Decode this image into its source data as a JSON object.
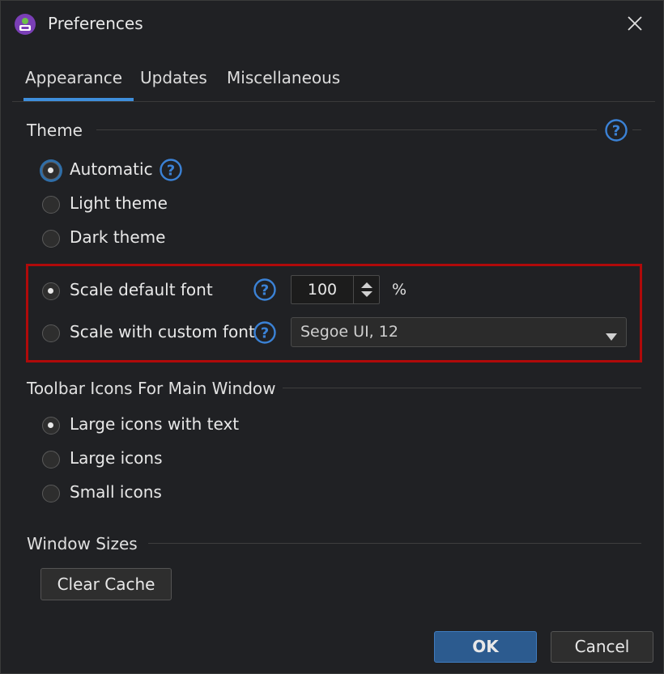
{
  "window": {
    "title": "Preferences"
  },
  "tabs": [
    {
      "label": "Appearance",
      "active": true
    },
    {
      "label": "Updates",
      "active": false
    },
    {
      "label": "Miscellaneous",
      "active": false
    }
  ],
  "theme": {
    "header": "Theme",
    "options": [
      {
        "label": "Automatic",
        "checked": true
      },
      {
        "label": "Light theme",
        "checked": false
      },
      {
        "label": "Dark theme",
        "checked": false
      }
    ]
  },
  "font": {
    "scale_default_label": "Scale default font",
    "scale_default_checked": true,
    "scale_value": "100",
    "unit": "%",
    "scale_custom_label": "Scale with custom font",
    "scale_custom_checked": false,
    "custom_font_value": "Segoe UI, 12"
  },
  "toolbar_icons": {
    "header": "Toolbar Icons For Main Window",
    "options": [
      {
        "label": "Large icons with text",
        "checked": true
      },
      {
        "label": "Large icons",
        "checked": false
      },
      {
        "label": "Small icons",
        "checked": false
      }
    ]
  },
  "window_sizes": {
    "header": "Window Sizes",
    "clear_cache_label": "Clear Cache"
  },
  "footer": {
    "ok_label": "OK",
    "cancel_label": "Cancel"
  },
  "colors": {
    "accent": "#3f8fdc",
    "highlight_border": "#b00a0a",
    "help_icon": "#3b82d6"
  },
  "icons": {
    "help": "question-circle-icon",
    "close": "close-icon",
    "app": "app-logo-icon",
    "dropdown": "chevron-down-icon",
    "spin": "spin-arrows-icon"
  }
}
